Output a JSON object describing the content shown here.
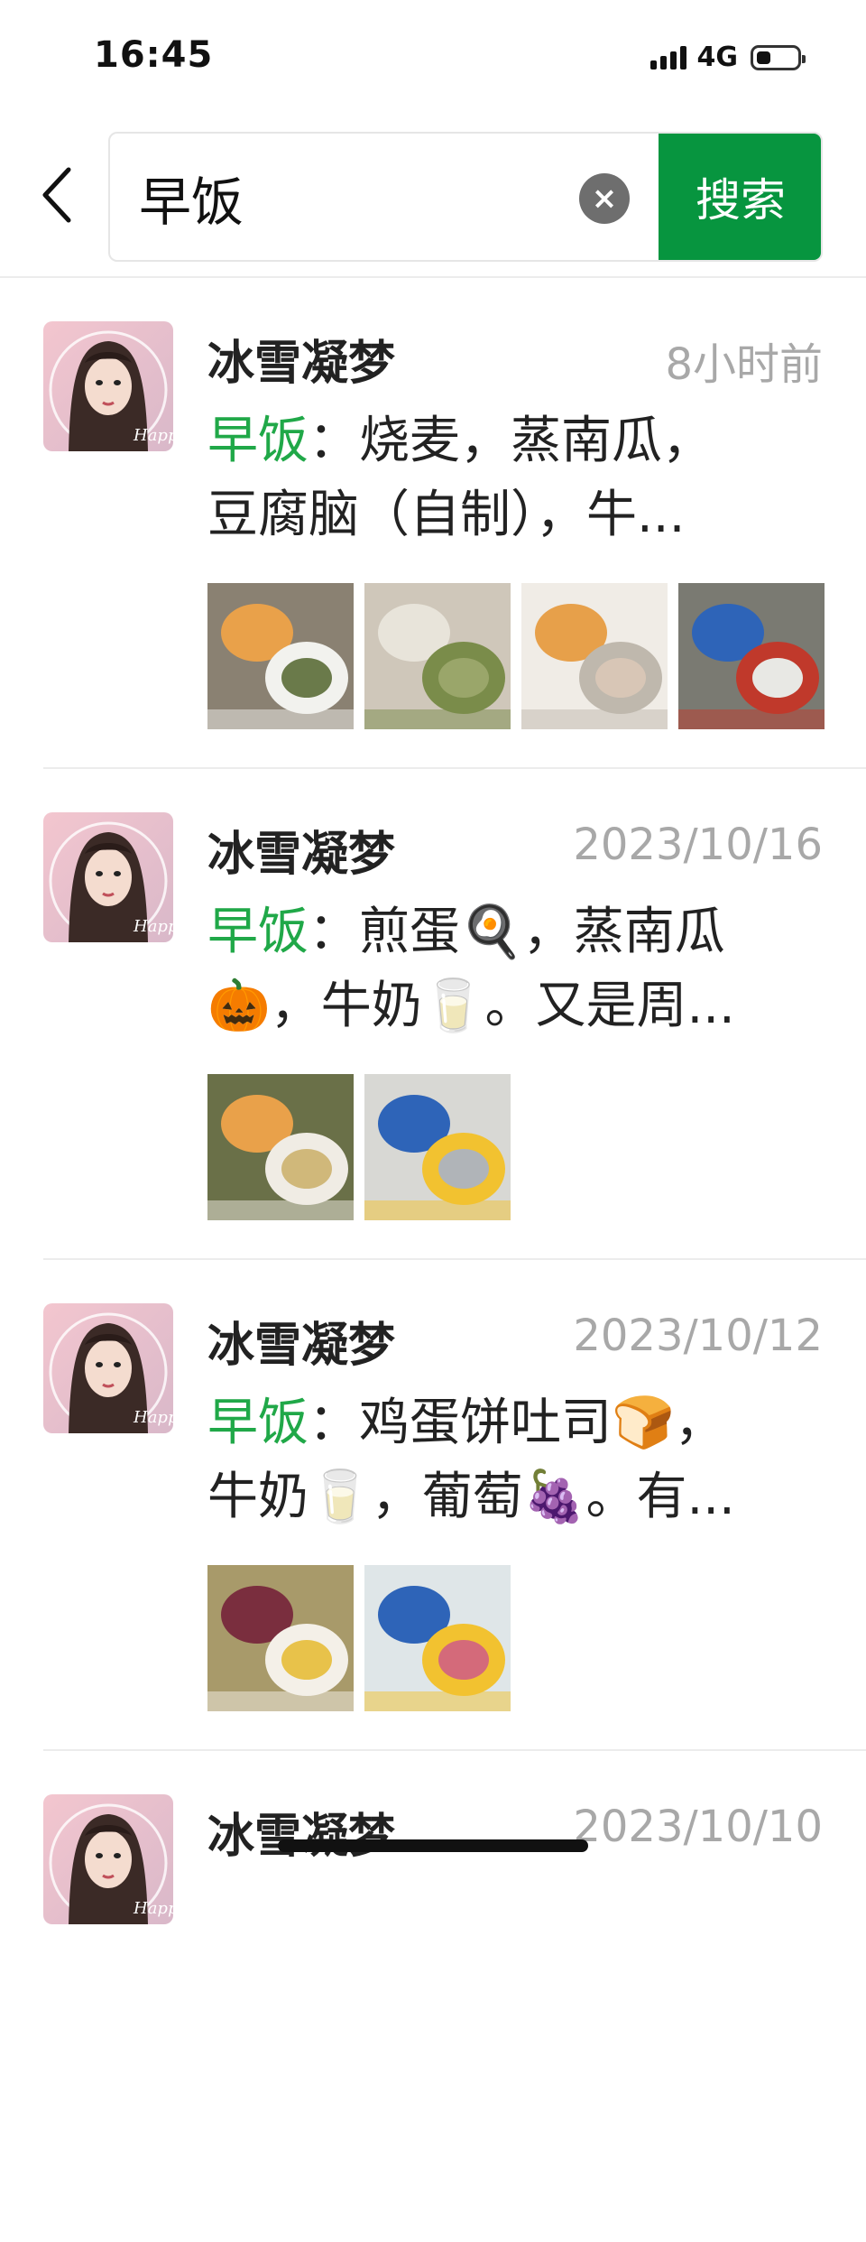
{
  "status_bar": {
    "time": "16:45",
    "network": "4G",
    "battery_level": 0.35
  },
  "search": {
    "query": "早饭",
    "clear_icon": "×",
    "button_label": "搜索"
  },
  "results": [
    {
      "name": "冰雪凝梦",
      "time": "8小时前",
      "keyword": "早饭",
      "snippet_line1": "：烧麦，蒸南瓜，",
      "snippet_line2": "豆腐脑（自制），牛...",
      "thumbnails": [
        "breakfast-table-photo",
        "tofu-pudding-bowl-photo",
        "tofu-pudding-eating-photo",
        "boy-in-school-uniform-photo"
      ]
    },
    {
      "name": "冰雪凝梦",
      "time": "2023/10/16",
      "keyword": "早饭",
      "snippet_line1": "：煎蛋🍳，蒸南瓜",
      "snippet_line2": "🎃，牛奶🥛。又是周...",
      "thumbnails": [
        "fried-egg-pumpkin-milk-photo",
        "boy-with-yellow-cap-photo"
      ]
    },
    {
      "name": "冰雪凝梦",
      "time": "2023/10/12",
      "keyword": "早饭",
      "snippet_line1": "：鸡蛋饼吐司🍞，",
      "snippet_line2": "牛奶🥛，葡萄🍇。有...",
      "thumbnails": [
        "grapes-milk-toast-photo",
        "boy-at-car-window-photo"
      ]
    },
    {
      "name": "冰雪凝梦",
      "time": "2023/10/10",
      "keyword": "",
      "snippet_line1": "",
      "snippet_line2": "",
      "thumbnails": []
    }
  ]
}
